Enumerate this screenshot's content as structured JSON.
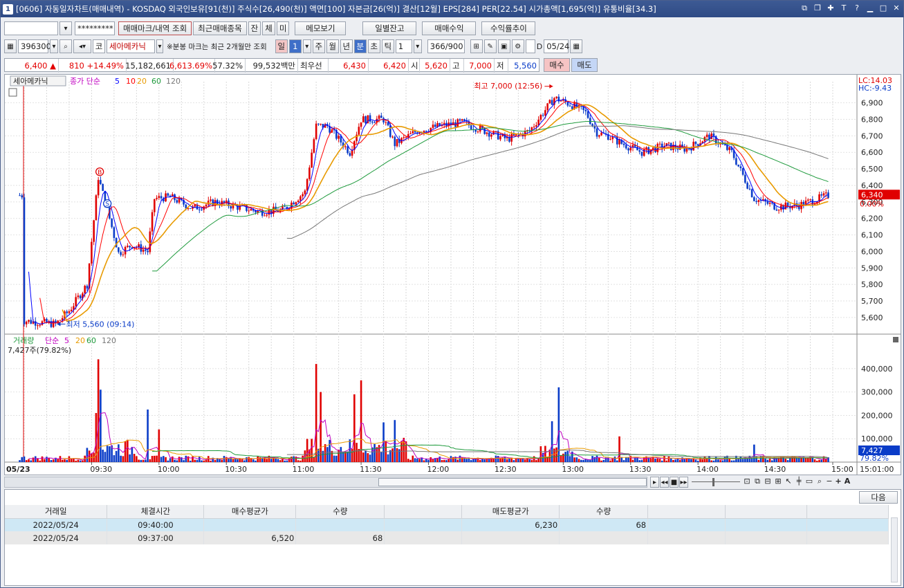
{
  "window": {
    "title_num": "1",
    "title": "[0606] 자동일자차트(매매내역) - KOSDAQ 외국인보유[91(천)] 주식수[26,490(천)] 액면[100] 자본금[26(억)] 결산[12월] EPS[284] PER[22.54] 시가총액[1,695(억)] 유통비율[34.3]"
  },
  "toolbar1": {
    "account": "",
    "password": "*********",
    "btn_trade_mark": "매매마크/내역 조회",
    "btn_recent": "최근매매종목",
    "btn_jan": "잔",
    "btn_che": "체",
    "btn_mi": "미",
    "btn_memo": "메모보기",
    "btn_daily": "일별잔고",
    "btn_profit": "매매수익",
    "btn_return": "수익률추이"
  },
  "toolbar2": {
    "code": "396300",
    "market": "코",
    "name": "세아메카닉",
    "note": "※분봉 마크는 최근 2개월만 조회",
    "periods": [
      "일",
      "1",
      "주",
      "월",
      "년",
      "분",
      "초",
      "틱"
    ],
    "tick_value": "1",
    "count": "366/900",
    "d_label": "D",
    "date": "05/24"
  },
  "quote": {
    "price": "6,400",
    "arrow": "▲",
    "change": "810",
    "rate": "+14.49%",
    "volume": "15,182,661",
    "vol_rate": "6,613.69%",
    "ratio": "57.32%",
    "amount": "99,532백만",
    "best_label": "최우선",
    "ask": "6,430",
    "bid": "6,420",
    "open_label": "시",
    "open": "5,620",
    "high_label": "고",
    "high": "7,000",
    "low_label": "저",
    "low": "5,560",
    "buy": "매수",
    "sell": "매도"
  },
  "chart_data": [
    {
      "type": "candlestick",
      "title": "세아메카닉",
      "indicator": "종가 단순",
      "ma_periods": [
        "5",
        "10",
        "20",
        "60",
        "120"
      ],
      "ma_colors": [
        "#0000ff",
        "#ff0000",
        "#e89a00",
        "#1e9a3c",
        "#777777"
      ],
      "x_tick_labels": [
        "05/23",
        "09:30",
        "10:00",
        "10:30",
        "11:00",
        "11:30",
        "12:00",
        "12:30",
        "13:00",
        "13:30",
        "14:00",
        "14:30",
        "15:00",
        "15:01:00"
      ],
      "y_tick_labels": [
        "5,600",
        "5,700",
        "5,800",
        "5,900",
        "6,000",
        "6,100",
        "6,200",
        "6,300",
        "6,400",
        "6,500",
        "6,600",
        "6,700",
        "6,800",
        "6,900"
      ],
      "ylim": [
        5520,
        7020
      ],
      "lc": "LC:14.03",
      "hc": "HC:-9.43",
      "high_annot": "최고 7,000 (12:56)",
      "low_annot": "최저 5,560 (09:14)",
      "last_price": "6,340",
      "last_rate": "0.00%",
      "mark_b": "B",
      "mark_s": "S",
      "anchors": [
        [
          "09:00",
          5580
        ],
        [
          "09:14",
          5560
        ],
        [
          "09:20",
          5640
        ],
        [
          "09:28",
          5800
        ],
        [
          "09:33",
          6450
        ],
        [
          "09:38",
          6200
        ],
        [
          "09:42",
          5990
        ],
        [
          "09:48",
          6040
        ],
        [
          "09:55",
          6000
        ],
        [
          "09:58",
          6320
        ],
        [
          "10:05",
          6330
        ],
        [
          "10:15",
          6260
        ],
        [
          "10:25",
          6300
        ],
        [
          "10:35",
          6270
        ],
        [
          "10:45",
          6240
        ],
        [
          "10:55",
          6250
        ],
        [
          "11:05",
          6360
        ],
        [
          "11:10",
          6760
        ],
        [
          "11:15",
          6760
        ],
        [
          "11:25",
          6600
        ],
        [
          "11:30",
          6800
        ],
        [
          "11:40",
          6800
        ],
        [
          "11:45",
          6650
        ],
        [
          "11:55",
          6730
        ],
        [
          "12:05",
          6760
        ],
        [
          "12:15",
          6780
        ],
        [
          "12:25",
          6730
        ],
        [
          "12:35",
          6680
        ],
        [
          "12:45",
          6730
        ],
        [
          "12:56",
          6930
        ],
        [
          "13:05",
          6880
        ],
        [
          "13:10",
          6840
        ],
        [
          "13:15",
          6720
        ],
        [
          "13:20",
          6700
        ],
        [
          "13:25",
          6660
        ],
        [
          "13:35",
          6600
        ],
        [
          "13:45",
          6640
        ],
        [
          "13:55",
          6620
        ],
        [
          "14:05",
          6700
        ],
        [
          "14:15",
          6600
        ],
        [
          "14:25",
          6320
        ],
        [
          "14:35",
          6270
        ],
        [
          "14:45",
          6280
        ],
        [
          "14:58",
          6340
        ]
      ]
    },
    {
      "type": "bar",
      "title": "거래량",
      "indicator": "단순",
      "ma_periods": [
        "5",
        "20",
        "60",
        "120"
      ],
      "ma_colors": [
        "#c000c0",
        "#e89a00",
        "#1e9a3c",
        "#777777"
      ],
      "last_label": "7,427주(79.82%)",
      "y_tick_labels": [
        "100,000",
        "200,000",
        "300,000",
        "400,000"
      ],
      "ylim": [
        0,
        450000
      ],
      "last_value": "7,427",
      "last_rate": "79.82%",
      "spikes": [
        [
          "09:33",
          440000
        ],
        [
          "09:34",
          310000
        ],
        [
          "09:32",
          210000
        ],
        [
          "09:55",
          225000
        ],
        [
          "10:00",
          140000
        ],
        [
          "11:10",
          420000
        ],
        [
          "11:12",
          300000
        ],
        [
          "11:30",
          350000
        ],
        [
          "11:27",
          290000
        ],
        [
          "11:40",
          170000
        ],
        [
          "11:45",
          180000
        ],
        [
          "12:55",
          175000
        ],
        [
          "12:58",
          320000
        ],
        [
          "13:25",
          110000
        ],
        [
          "14:25",
          75000
        ]
      ]
    }
  ],
  "scrollbar": {
    "minus": "−",
    "plus": "+",
    "a": "A"
  },
  "bottom": {
    "next_btn": "다음",
    "headers": [
      "거래일",
      "체결시간",
      "매수평균가",
      "수량",
      "",
      "매도평균가",
      "수량",
      "",
      "",
      ""
    ],
    "rows": [
      [
        "2022/05/24",
        "09:40:00",
        "",
        "",
        "",
        "6,230",
        "68",
        "",
        "",
        ""
      ],
      [
        "2022/05/24",
        "09:37:00",
        "6,520",
        "68",
        "",
        "",
        "",
        "",
        "",
        ""
      ]
    ]
  }
}
